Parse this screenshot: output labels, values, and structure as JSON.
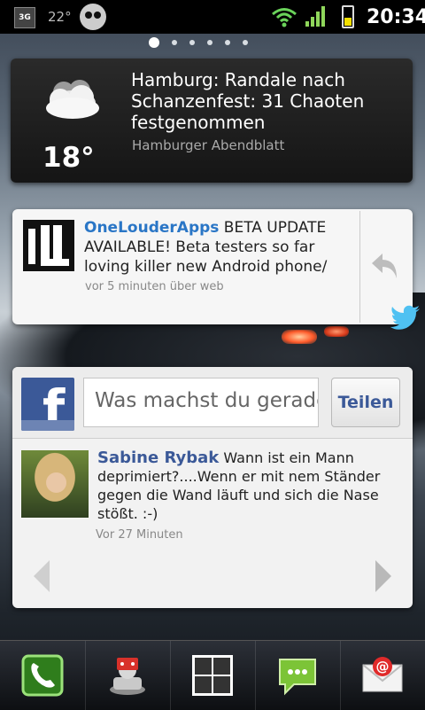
{
  "status_bar": {
    "network": "3G",
    "temperature": "22°",
    "time": "20:34",
    "battery_level": 0.4,
    "icons": [
      "3g-icon",
      "android-icon",
      "wifi-icon",
      "signal-icon",
      "battery-icon"
    ]
  },
  "home": {
    "page_count": 6,
    "active_page": 1
  },
  "news_widget": {
    "temperature": "18°",
    "headline": "Hamburg: Randale nach Schanzenfest: 31 Chaoten festgenommen",
    "source": "Hamburger Abendblatt",
    "icon": "cloud-icon"
  },
  "twitter_widget": {
    "username": "OneLouderApps",
    "tweet": " BETA UPDATE AVAILABLE! Beta testers so far loving killer new Android phone/",
    "meta": "vor 5 minuten über web",
    "icons": [
      "reply-icon",
      "twitter-bird-icon"
    ]
  },
  "facebook_widget": {
    "input_placeholder": "Was machst du gerade?",
    "share_label": "Teilen",
    "post_author": "Sabine Rybak",
    "post_text": " Wann ist ein Mann deprimiert?....Wenn er mit nem Ständer gegen die Wand läuft und sich die Nase stößt. :-)",
    "post_time": "Vor 27 Minuten"
  },
  "dock": {
    "items": [
      "phone-icon",
      "contacts-icon",
      "app-drawer-icon",
      "messaging-icon",
      "email-icon"
    ]
  },
  "colors": {
    "twitter_blue": "#2a76c6",
    "facebook_blue": "#3b5998"
  }
}
